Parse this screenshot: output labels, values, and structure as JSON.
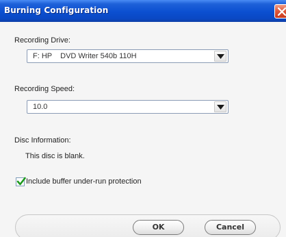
{
  "window": {
    "title": "Burning Configuration"
  },
  "recording_drive": {
    "label": "Recording Drive:",
    "selected": "F: HP    DVD Writer 540b 110H"
  },
  "recording_speed": {
    "label": "Recording Speed:",
    "selected": "10.0"
  },
  "disc_info": {
    "label": "Disc Information:",
    "status": "This disc is blank."
  },
  "buffer_protection": {
    "label": "Include buffer under-run protection",
    "checked": true
  },
  "buttons": {
    "ok": "OK",
    "cancel": "Cancel"
  },
  "icons": {
    "close": "close-icon",
    "dropdown": "chevron-down-icon",
    "check": "checkmark-icon"
  },
  "colors": {
    "titlebar": "#0b4fd0",
    "close": "#e05a3c",
    "check": "#1e9a1e"
  }
}
